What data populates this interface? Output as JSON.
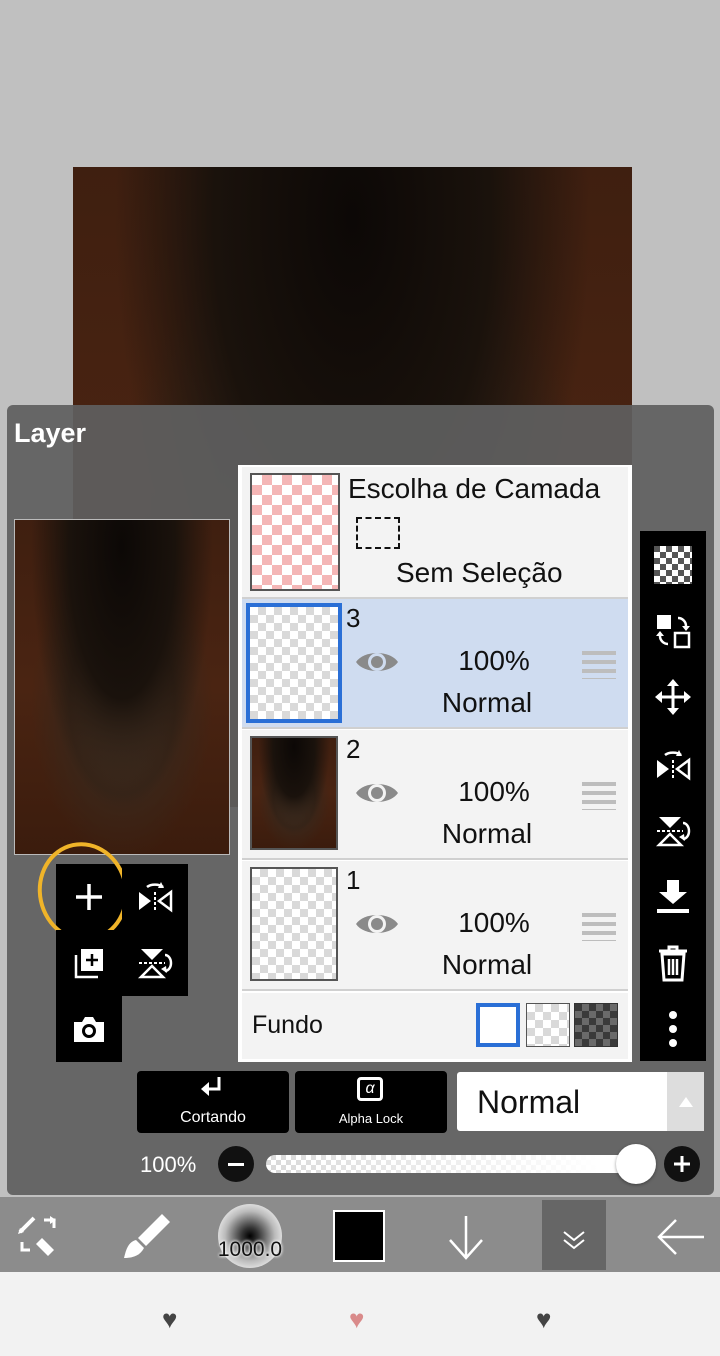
{
  "panel": {
    "title": "Layer"
  },
  "selection_layer": {
    "title": "Escolha de Camada",
    "status": "Sem Seleção"
  },
  "layers": [
    {
      "number": "3",
      "opacity": "100%",
      "blend": "Normal",
      "selected": true
    },
    {
      "number": "2",
      "opacity": "100%",
      "blend": "Normal",
      "selected": false
    },
    {
      "number": "1",
      "opacity": "100%",
      "blend": "Normal",
      "selected": false
    }
  ],
  "background_row": {
    "label": "Fundo"
  },
  "actions": {
    "clipping_label": "Cortando",
    "alpha_lock_label": "Alpha Lock",
    "alpha_symbol": "α"
  },
  "blend_mode": {
    "value": "Normal"
  },
  "opacity_slider": {
    "label": "100%",
    "value_percent": 100
  },
  "toolbar": {
    "brush_size": "1000.0"
  },
  "colors": {
    "accent": "#2a6fd6",
    "selected_row": "#cfdcf0",
    "highlight_circle": "#f0b429",
    "heart_active": "#d98a8a"
  }
}
